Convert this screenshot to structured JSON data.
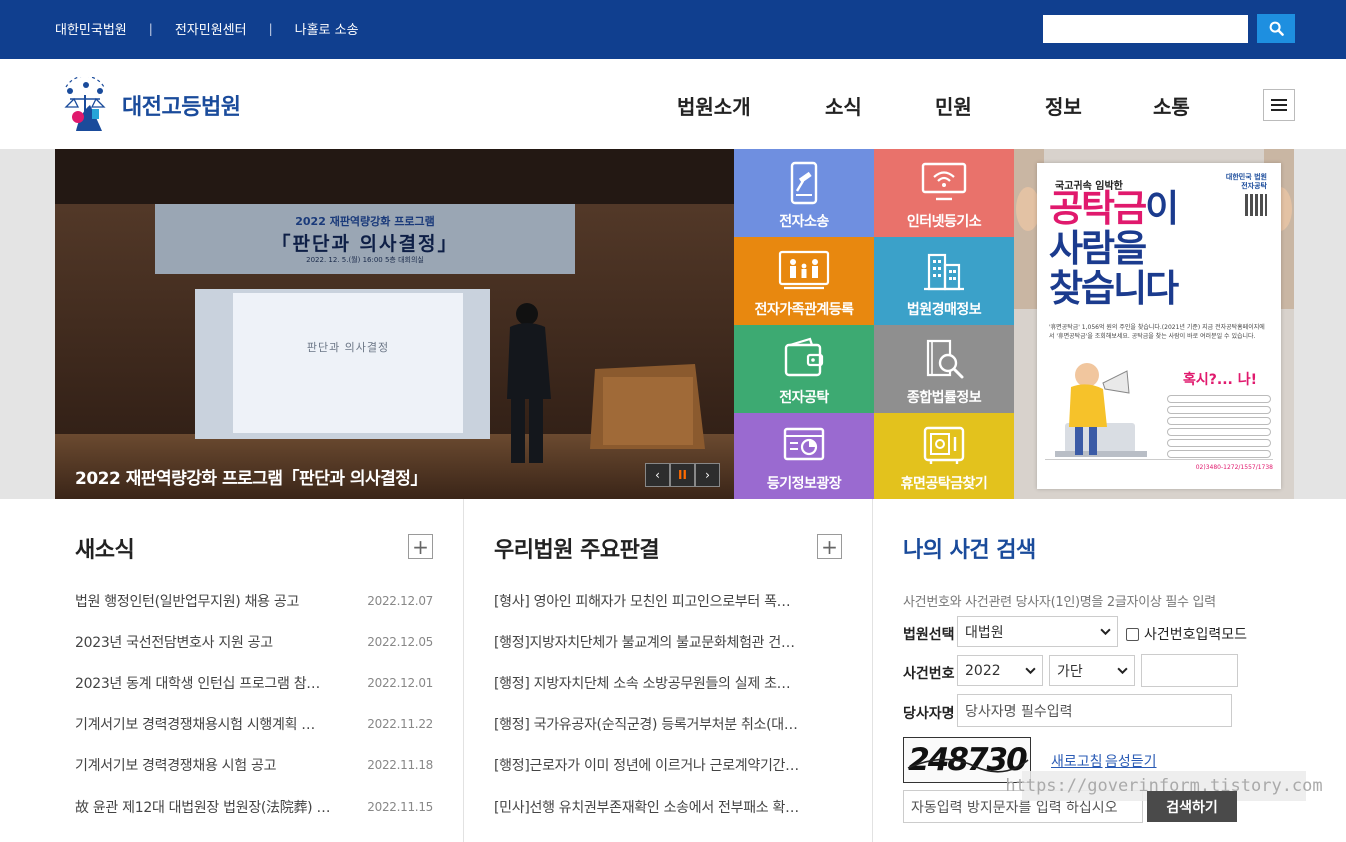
{
  "topbar": {
    "links": [
      "대한민국법원",
      "전자민원센터",
      "나홀로 소송"
    ],
    "separator": "|"
  },
  "header": {
    "logo_text": "대전고등법원",
    "nav": [
      "법원소개",
      "소식",
      "민원",
      "정보",
      "소통"
    ]
  },
  "slide": {
    "banner_line1": "2022 재판역량강화 프로그램",
    "banner_line2": "「판단과 의사결정」",
    "banner_line3": "2022. 12. 5.(월) 16:00  5층 대회의실",
    "screen_text": "판단과 의사결정",
    "caption": "2022 재판역량강화 프로그램「판단과 의사결정」",
    "prev": "‹",
    "pause": "II",
    "next": "›"
  },
  "tiles": [
    {
      "label": "전자소송",
      "color": "#6f8fe0",
      "icon": "tablet-gavel-icon"
    },
    {
      "label": "인터넷등기소",
      "color": "#e9726b",
      "icon": "monitor-wifi-icon"
    },
    {
      "label": "전자가족관계등록",
      "color": "#e8880f",
      "icon": "family-icon"
    },
    {
      "label": "법원경매정보",
      "color": "#3ba1c9",
      "icon": "buildings-icon"
    },
    {
      "label": "전자공탁",
      "color": "#3daa72",
      "icon": "wallet-icon"
    },
    {
      "label": "종합법률정보",
      "color": "#8f8f8f",
      "icon": "book-search-icon"
    },
    {
      "label": "등기정보광장",
      "color": "#9a6ad0",
      "icon": "register-chart-icon"
    },
    {
      "label": "휴면공탁금찾기",
      "color": "#e3c21d",
      "icon": "safe-icon"
    }
  ],
  "poster": {
    "subtitle": "국고귀속 임박한",
    "badge_line1": "대한민국 법원",
    "badge_line2": "전자공탁",
    "title_pink": "공탁금",
    "title_blue_1": "이",
    "title_line2": "사람을",
    "title_line3": "찾습니다",
    "body": "'휴면공탁금' 1,056억 원의 주인을 찾습니다.(2021년 기준) 지금 전자공탁홈페이지에서 '휴면공탁금'을 조회해보세요. 공탁금을 찾는 사람이 바로 여러분일 수 있습니다.",
    "bubble": "혹시?... 나!",
    "phone": "02)3480-1272/1557/1738"
  },
  "news": {
    "title": "새소식",
    "plus": "+",
    "items": [
      {
        "title": "법원 행정인턴(일반업무지원) 채용 공고",
        "date": "2022.12.07"
      },
      {
        "title": "2023년 국선전담변호사 지원 공고",
        "date": "2022.12.05"
      },
      {
        "title": "2023년 동계 대학생 인턴십 프로그램 참…",
        "date": "2022.12.01"
      },
      {
        "title": "기계서기보 경력경쟁채용시험 시행계획 …",
        "date": "2022.11.22"
      },
      {
        "title": "기계서기보 경력경쟁채용 시험 공고",
        "date": "2022.11.18"
      },
      {
        "title": "故 윤관 제12대 대법원장 법원장(法院葬) …",
        "date": "2022.11.15"
      }
    ]
  },
  "rulings": {
    "title": "우리법원 주요판결",
    "plus": "+",
    "items": [
      "[형사] 영아인 피해자가 모친인 피고인으로부터 폭…",
      "[행정]지방자치단체가 불교계의 불교문화체험관 건…",
      "[행정] 지방자치단체 소속 소방공무원들의 실제 초…",
      "[행정] 국가유공자(순직군경) 등록거부처분 취소(대…",
      "[행정]근로자가 이미 정년에 이르거나 근로계약기간…",
      "[민사]선행 유치권부존재확인 소송에서 전부패소 확…"
    ]
  },
  "case_search": {
    "title": "나의 사건 검색",
    "desc": "사건번호와 사건관련 당사자(1인)명을 2글자이상 필수 입력",
    "court_label": "법원선택",
    "court_value": "대법원",
    "mode_label": "사건번호입력모드",
    "case_no_label": "사건번호",
    "year_value": "2022",
    "type_value": "가단",
    "party_label": "당사자명",
    "party_placeholder": "당사자명 필수입력",
    "captcha_text": "248730",
    "refresh_label": "새로고침",
    "audio_label": "음성듣기",
    "captcha_placeholder": "자동입력 방지문자를 입력 하십시오",
    "search_label": "검색하기"
  },
  "watermark": "https://goverinform.tistory.com",
  "colors": {
    "topbar": "#103f8f",
    "brand": "#1a4b9b",
    "search_button": "#1e8fe0"
  }
}
